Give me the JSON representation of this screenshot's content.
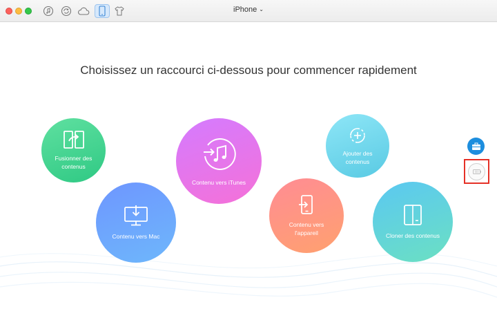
{
  "window": {
    "device_name": "iPhone",
    "caret": "⌄"
  },
  "toolbar": {
    "items": [
      {
        "icon": "music-note-icon"
      },
      {
        "icon": "sync-icon"
      },
      {
        "icon": "cloud-icon"
      },
      {
        "icon": "phone-icon",
        "active": true
      },
      {
        "icon": "tshirt-icon"
      }
    ]
  },
  "main": {
    "headline": "Choisissez un raccourci ci-dessous pour commencer rapidement",
    "shortcuts": {
      "merge": {
        "label": "Fusionner des contenus",
        "icon": "merge-icon"
      },
      "to_mac": {
        "label": "Contenu vers Mac",
        "icon": "computer-download-icon"
      },
      "to_itunes": {
        "label": "Contenu vers iTunes",
        "icon": "itunes-transfer-icon"
      },
      "to_device": {
        "label": "Contenu vers l'appareil",
        "icon": "device-transfer-icon"
      },
      "add": {
        "label": "Ajouter des contenus",
        "icon": "add-content-icon"
      },
      "clone": {
        "label": "Cloner des contenus",
        "icon": "clone-icon"
      }
    }
  },
  "side": {
    "toolbox_icon": "toolbox-icon",
    "battery_icon": "battery-icon"
  },
  "colors": {
    "accent_blue": "#1d8ede",
    "highlight_red": "#e53026"
  }
}
